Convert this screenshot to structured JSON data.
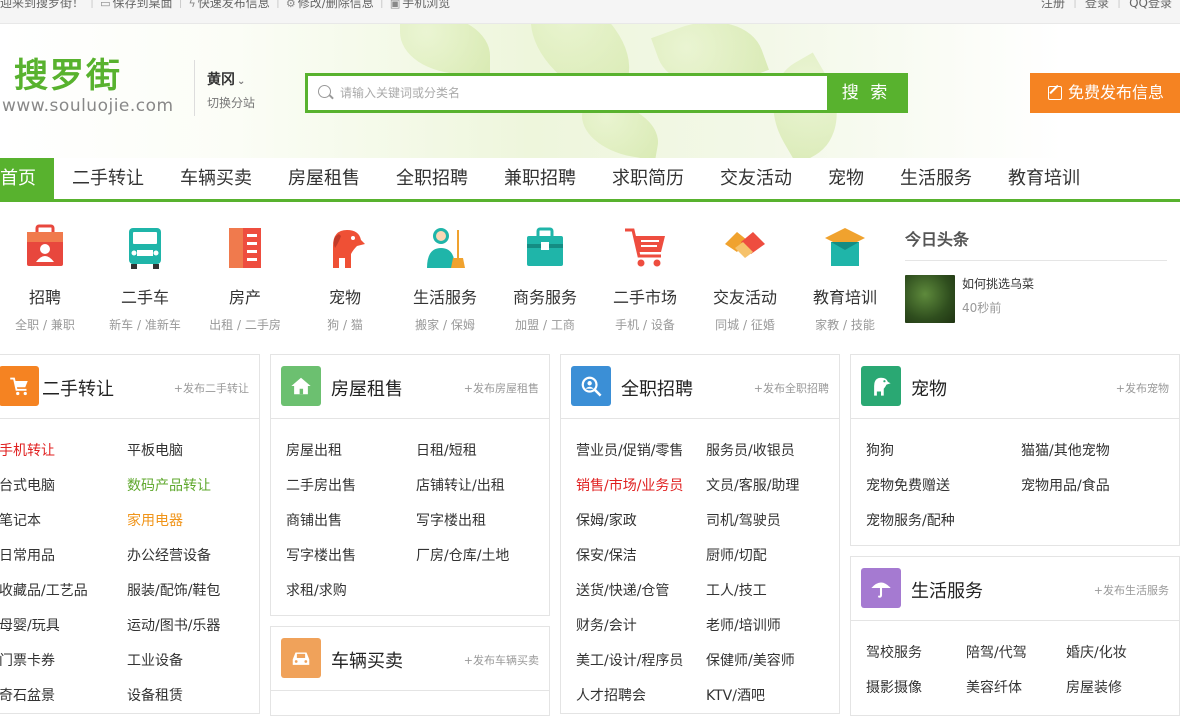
{
  "topbar": {
    "welcome": "迎来到搜罗街！",
    "save_desktop": "保存到桌面",
    "quick_post": "快速发布信息",
    "edit_delete": "修改/删除信息",
    "mobile": "手机浏览",
    "register": "注册",
    "login": "登录",
    "qq_login": "QQ登录"
  },
  "header": {
    "logo": "搜罗街",
    "logo_url": "www.souluojie.com",
    "city": "黄冈",
    "switch_city": "切换分站",
    "search_placeholder": "请输入关键词或分类名",
    "search_button": "搜 索",
    "post_button": "免费发布信息"
  },
  "nav": [
    "首页",
    "二手转让",
    "车辆买卖",
    "房屋租售",
    "全职招聘",
    "兼职招聘",
    "求职简历",
    "交友活动",
    "宠物",
    "生活服务",
    "教育培训"
  ],
  "categories": [
    {
      "name": "招聘",
      "sub": "全职 / 兼职",
      "color": "#e8473d"
    },
    {
      "name": "二手车",
      "sub": "新车 / 准新车",
      "color": "#1fb5a9"
    },
    {
      "name": "房产",
      "sub": "出租 / 二手房",
      "color": "#ee4d3f"
    },
    {
      "name": "宠物",
      "sub": "狗 / 猫",
      "color": "#ef5035"
    },
    {
      "name": "生活服务",
      "sub": "搬家 / 保姆",
      "color": "#1fb5a9"
    },
    {
      "name": "商务服务",
      "sub": "加盟 / 工商",
      "color": "#1fb5a9"
    },
    {
      "name": "二手市场",
      "sub": "手机 / 设备",
      "color": "#ee4d3f"
    },
    {
      "name": "交友活动",
      "sub": "同城 / 征婚",
      "color": "#f0a22e"
    },
    {
      "name": "教育培训",
      "sub": "家教 / 技能",
      "color": "#1fb5a9"
    }
  ],
  "headline": {
    "title": "今日头条",
    "news_title": "如何挑选乌菜",
    "news_time": "40秒前"
  },
  "sections": {
    "secondhand": {
      "title": "二手转让",
      "post": "+发布二手转让",
      "color": "#f58322",
      "links": [
        "手机转让",
        "平板电脑",
        "台式电脑",
        "数码产品转让",
        "笔记本",
        "家用电器",
        "日常用品",
        "办公经营设备",
        "收藏品/工艺品",
        "服装/配饰/鞋包",
        "母婴/玩具",
        "运动/图书/乐器",
        "门票卡券",
        "工业设备",
        "奇石盆景",
        "设备租赁"
      ]
    },
    "house": {
      "title": "房屋租售",
      "post": "+发布房屋租售",
      "color": "#6cc070",
      "links": [
        "房屋出租",
        "日租/短租",
        "二手房出售",
        "店铺转让/出租",
        "商铺出售",
        "写字楼出租",
        "写字楼出售",
        "厂房/仓库/土地",
        "求租/求购"
      ]
    },
    "cars": {
      "title": "车辆买卖",
      "post": "+发布车辆买卖",
      "color": "#f0a25a"
    },
    "jobs": {
      "title": "全职招聘",
      "post": "+发布全职招聘",
      "color": "#3b8fd6",
      "links": [
        "营业员/促销/零售",
        "服务员/收银员",
        "销售/市场/业务员",
        "文员/客服/助理",
        "保姆/家政",
        "司机/驾驶员",
        "保安/保洁",
        "厨师/切配",
        "送货/快递/仓管",
        "工人/技工",
        "财务/会计",
        "老师/培训师",
        "美工/设计/程序员",
        "保健师/美容师",
        "人才招聘会",
        "KTV/酒吧"
      ]
    },
    "pets": {
      "title": "宠物",
      "post": "+发布宠物",
      "color": "#2aa873",
      "links": [
        "狗狗",
        "猫猫/其他宠物",
        "宠物免费赠送",
        "宠物用品/食品",
        "宠物服务/配种"
      ]
    },
    "life": {
      "title": "生活服务",
      "post": "+发布生活服务",
      "color": "#a57ad1",
      "links": [
        "驾校服务",
        "陪驾/代驾",
        "婚庆/化妆",
        "摄影摄像",
        "美容纤体",
        "房屋装修"
      ]
    }
  }
}
